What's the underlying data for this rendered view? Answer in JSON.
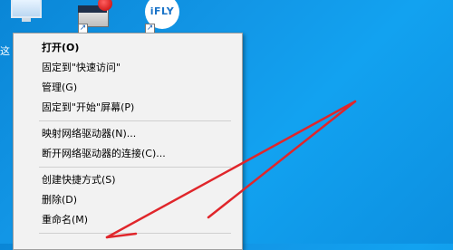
{
  "desktop": {
    "icons": [
      {
        "name": "this-pc",
        "label": "这"
      },
      {
        "name": "app-shortcut",
        "label": ""
      },
      {
        "name": "ifly",
        "label": "iFLY"
      }
    ]
  },
  "context_menu": {
    "items": [
      {
        "label": "打开(O)",
        "bold": true
      },
      {
        "label": "固定到\"快速访问\""
      },
      {
        "label": "管理(G)"
      },
      {
        "label": "固定到\"开始\"屏幕(P)"
      },
      {
        "label": "映射网络驱动器(N)..."
      },
      {
        "label": "断开网络驱动器的连接(C)..."
      },
      {
        "label": "创建快捷方式(S)"
      },
      {
        "label": "删除(D)"
      },
      {
        "label": "重命名(M)"
      }
    ]
  },
  "colors": {
    "desktop_blue": "#0a8ee0",
    "menu_bg": "#f2f2f2",
    "arrow_red": "#e0262b"
  }
}
